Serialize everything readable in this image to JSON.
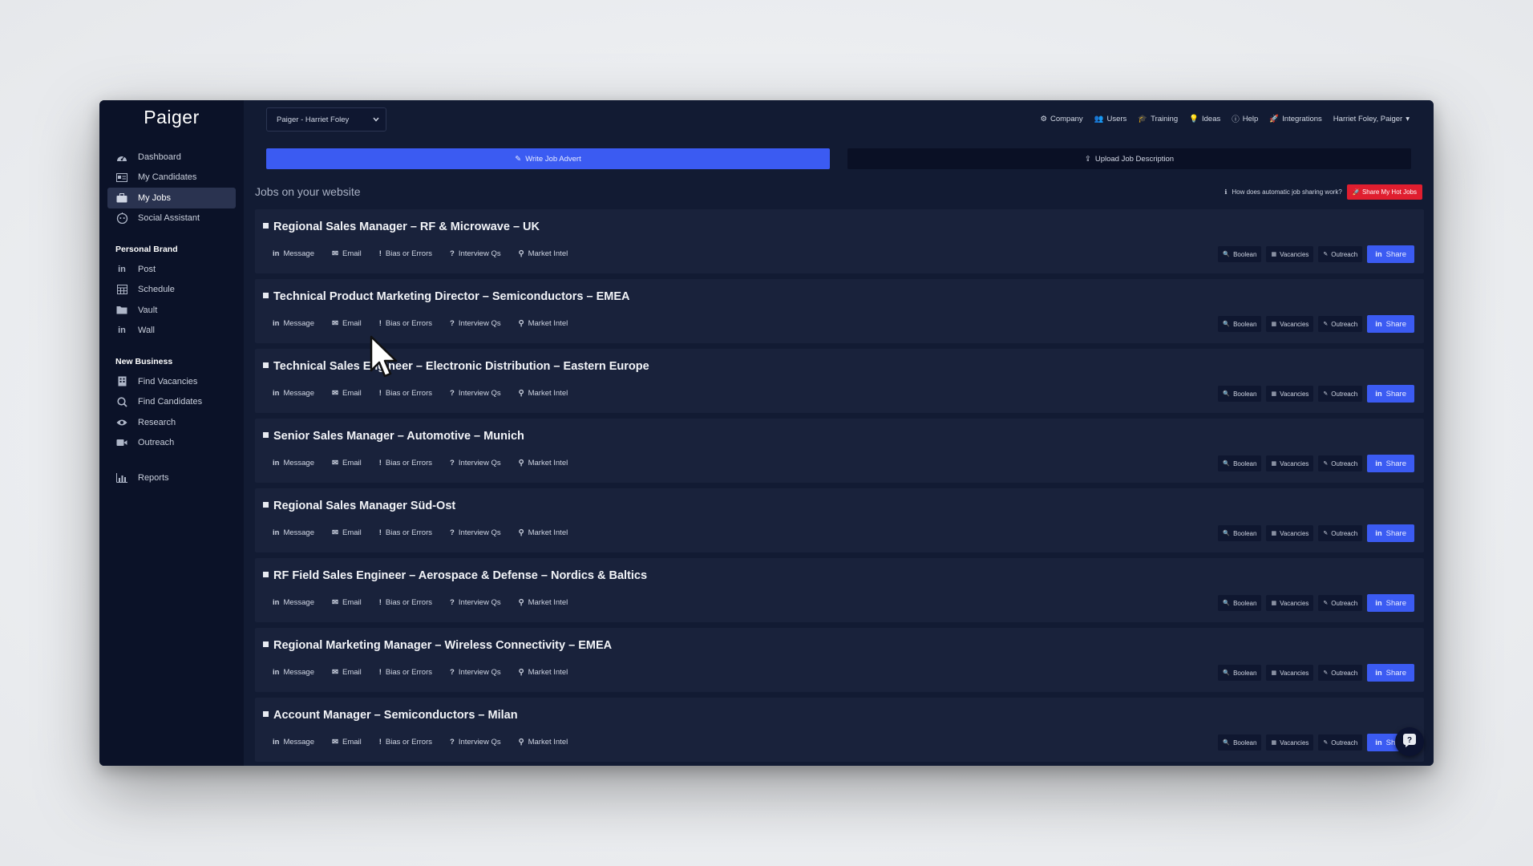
{
  "app": {
    "logo": "Paiger",
    "account_select": "Paiger - Harriet Foley",
    "top_menu": [
      {
        "label": "Company",
        "icon": "gear-icon"
      },
      {
        "label": "Users",
        "icon": "users-icon"
      },
      {
        "label": "Training",
        "icon": "graduation-cap-icon"
      },
      {
        "label": "Ideas",
        "icon": "lightbulb-icon"
      },
      {
        "label": "Help",
        "icon": "info-icon"
      },
      {
        "label": "Integrations",
        "icon": "rocket-icon"
      },
      {
        "label": "Harriet Foley, Paiger",
        "icon": "caret-down-icon"
      }
    ]
  },
  "sidebar": {
    "main_items": [
      {
        "label": "Dashboard",
        "icon": "dashboard-icon"
      },
      {
        "label": "My Candidates",
        "icon": "id-card-icon"
      },
      {
        "label": "My Jobs",
        "icon": "briefcase-icon",
        "active": true
      },
      {
        "label": "Social Assistant",
        "icon": "robot-icon"
      }
    ],
    "personal_brand_title": "Personal Brand",
    "personal_brand_items": [
      {
        "label": "Post",
        "icon": "linkedin-icon"
      },
      {
        "label": "Schedule",
        "icon": "calendar-icon"
      },
      {
        "label": "Vault",
        "icon": "folder-icon"
      },
      {
        "label": "Wall",
        "icon": "linkedin-icon"
      }
    ],
    "new_business_title": "New Business",
    "new_business_items": [
      {
        "label": "Find Vacancies",
        "icon": "building-icon"
      },
      {
        "label": "Find Candidates",
        "icon": "search-icon"
      },
      {
        "label": "Research",
        "icon": "eye-icon"
      },
      {
        "label": "Outreach",
        "icon": "video-icon"
      }
    ],
    "reports": {
      "label": "Reports",
      "icon": "bar-chart-icon"
    }
  },
  "actions": {
    "write_job_advert": "Write Job Advert",
    "upload_job_description": "Upload Job Description"
  },
  "jobs_section": {
    "title": "Jobs on your website",
    "help_text": "How does automatic job sharing work?",
    "hot_jobs_button": "Share My Hot Jobs"
  },
  "job_actions": [
    "Message",
    "Email",
    "Bias or Errors",
    "Interview Qs",
    "Market Intel"
  ],
  "job_tools": [
    "Boolean",
    "Vacancies",
    "Outreach"
  ],
  "share_label": "Share",
  "jobs": [
    {
      "title": "Regional Sales Manager – RF & Microwave – UK"
    },
    {
      "title": "Technical Product Marketing Director – Semiconductors – EMEA"
    },
    {
      "title": "Technical Sales Engineer – Electronic Distribution – Eastern Europe"
    },
    {
      "title": "Senior Sales Manager – Automotive – Munich"
    },
    {
      "title": "Regional Sales Manager Süd-Ost"
    },
    {
      "title": "RF Field Sales Engineer – Aerospace & Defense – Nordics & Baltics"
    },
    {
      "title": "Regional Marketing Manager – Wireless Connectivity – EMEA"
    },
    {
      "title": "Account Manager – Semiconductors – Milan"
    }
  ],
  "colors": {
    "accent": "#3b5bf2",
    "hot": "#e01e2f",
    "sidebar_bg": "#0b1228",
    "main_bg": "#121b33",
    "card_bg": "#19223b"
  }
}
